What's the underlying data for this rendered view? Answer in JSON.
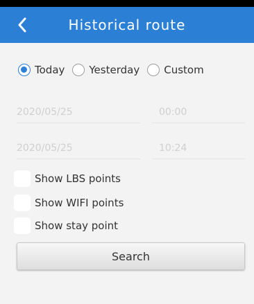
{
  "header": {
    "title": "Historical route",
    "back_icon": "chevron-left-icon",
    "background_color": "#2b7fd4"
  },
  "range": {
    "selected": "Today",
    "options": [
      "Today",
      "Yesterday",
      "Custom"
    ]
  },
  "start": {
    "date": "2020/05/25",
    "time": "00:00"
  },
  "end": {
    "date": "2020/05/25",
    "time": "10:24"
  },
  "options": [
    {
      "label": "Show LBS points",
      "checked": false
    },
    {
      "label": "Show WIFI points",
      "checked": false
    },
    {
      "label": "Show stay point",
      "checked": false
    }
  ],
  "search_label": "Search"
}
